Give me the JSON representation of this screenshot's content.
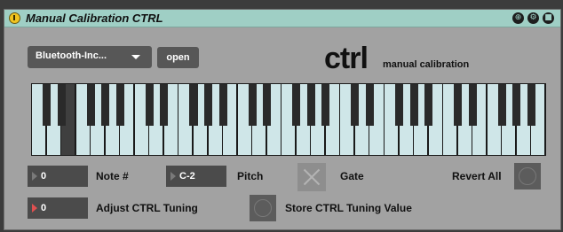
{
  "titlebar": {
    "title": "Manual Calibration CTRL",
    "icons": [
      "power-icon",
      "map-icon",
      "settings-icon",
      "save-icon"
    ]
  },
  "device": {
    "dropdown_value": "Bluetooth-Inc...",
    "open_label": "open",
    "logo": "ctrl",
    "logo_sub": "manual calibration"
  },
  "keyboard": {
    "white_key_count": 35,
    "active_white_key_index": 2
  },
  "controls": {
    "note_value": "0",
    "note_label": "Note #",
    "pitch_value": "C-2",
    "pitch_label": "Pitch",
    "gate_label": "Gate",
    "revert_label": "Revert All",
    "adjust_value": "0",
    "adjust_label": "Adjust CTRL Tuning",
    "store_label": "Store CTRL Tuning Value"
  },
  "colors": {
    "titlebar": "#9fcfc5",
    "panel": "#a2a2a2",
    "white_key": "#cfe6e8",
    "active_key": "#3f3f3f",
    "power": "#f0c420",
    "adjust_arrow": "#e05050"
  }
}
